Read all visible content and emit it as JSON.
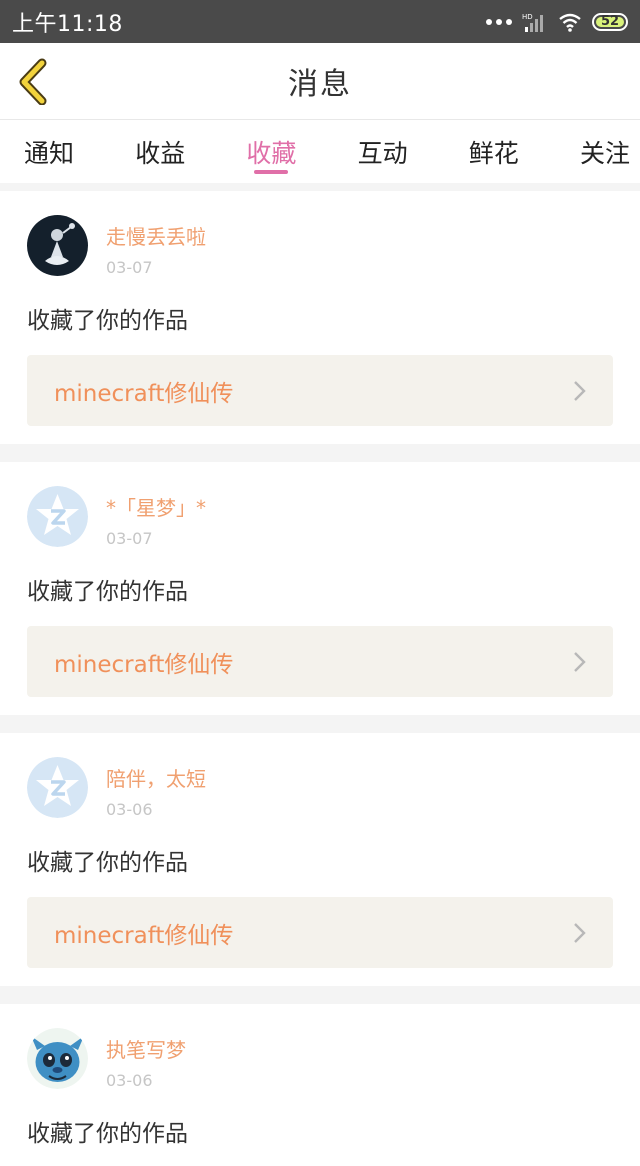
{
  "status_bar": {
    "time": "上午11:18",
    "battery": "52",
    "network": "HD"
  },
  "header": {
    "title": "消息"
  },
  "tabs": [
    {
      "label": "通知"
    },
    {
      "label": "收益"
    },
    {
      "label": "收藏",
      "active": true
    },
    {
      "label": "互动"
    },
    {
      "label": "鲜花"
    },
    {
      "label": "关注"
    }
  ],
  "messages": [
    {
      "user": "走慢丢丢啦",
      "date": "03-07",
      "action": "收藏了你的作品",
      "work": "minecraft修仙传",
      "avatar": "photo-avatar"
    },
    {
      "user": "*「星梦」*",
      "date": "03-07",
      "action": "收藏了你的作品",
      "work": "minecraft修仙传",
      "avatar": "default-avatar"
    },
    {
      "user": "陪伴，太短",
      "date": "03-06",
      "action": "收藏了你的作品",
      "work": "minecraft修仙传",
      "avatar": "default-avatar"
    },
    {
      "user": "执笔写梦",
      "date": "03-06",
      "action": "收藏了你的作品",
      "avatar": "cartoon-avatar"
    }
  ],
  "colors": {
    "accent": "#e06fa8",
    "username": "#f0a070",
    "work_title": "#f0905a",
    "back_arrow": "#f2d33c"
  }
}
